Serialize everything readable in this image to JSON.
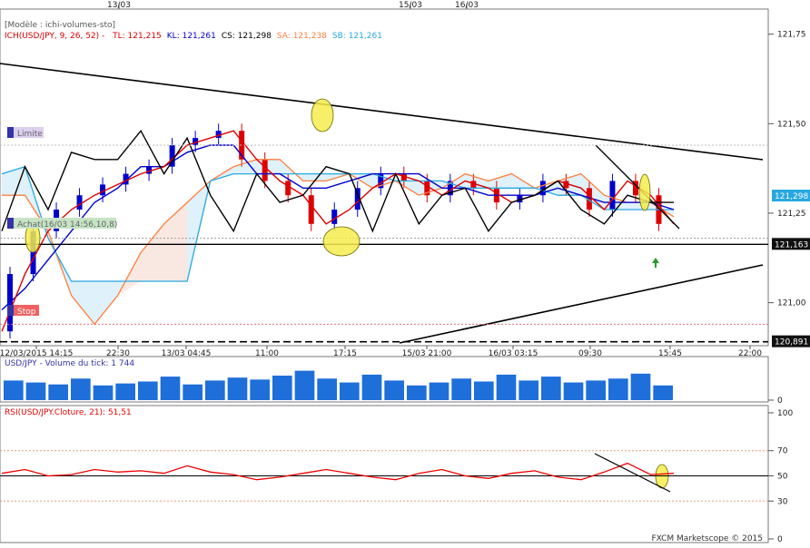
{
  "top_dates": [
    "13/03",
    "15/03",
    "16/03"
  ],
  "price_panel": {
    "model_label": "[Modèle : ichi-volumes-sto]",
    "ichimoku": {
      "prefix": "ICH(USD/JPY, 9, 26, 52) -",
      "items": [
        {
          "text": "TL: 121,215",
          "color": "#dd0000"
        },
        {
          "text": "KL: 121,261",
          "color": "#0000cc"
        },
        {
          "text": "CS: 121,298",
          "color": "#000000"
        },
        {
          "text": "SA: 121,238",
          "color": "#ff7f3f"
        },
        {
          "text": "SB: 121,261",
          "color": "#28a8e0"
        }
      ]
    },
    "y_ticks": [
      "121,75",
      "121,50",
      "121,25",
      "121,00"
    ],
    "limit_label": "Limite",
    "buy_label": "Achat(16/03 14:56,10,8)",
    "stop_label": "Stop",
    "price_boxes": [
      "121,298",
      "121,163",
      "120,891"
    ]
  },
  "time_axis": [
    "12/03/2015 14:15",
    "22:30",
    "13/03 04:45",
    "11:00",
    "17:15",
    "15/03 21:00",
    "16/03 03:15",
    "09:30",
    "15:45",
    "22:00"
  ],
  "volume_panel": {
    "title": "USD/JPY - Volume du tick: 1 744",
    "y_ticks": [
      "0"
    ]
  },
  "rsi_panel": {
    "title": "RSI(USD/JPY.Cloture, 21): 51,51",
    "y_ticks": [
      "100",
      "70",
      "50",
      "30",
      "0"
    ]
  },
  "footer": "FXCM Marketscope © 2015",
  "colors": {
    "tenkan": "#dd0000",
    "kijun": "#0000cc",
    "chikou": "#000000",
    "senkou_a": "#ff7f3f",
    "senkou_b": "#28a8e0",
    "candle_up": "#0000cc",
    "candle_down": "#dd0000",
    "volume": "#1e6fd9",
    "rsi": "#ee0000",
    "highlight": "#f5ec4c"
  },
  "chart_data": {
    "type": "line",
    "instrument": "USD/JPY",
    "price_range": [
      120.88,
      121.82
    ],
    "levels": {
      "limit": 121.44,
      "buy": 121.18,
      "stop": 120.94,
      "support_close": 121.163,
      "support_dashed": 120.891
    },
    "x_time": [
      "12/03/2015 14:15",
      "22:30",
      "13/03 04:45",
      "11:00",
      "17:15",
      "15/03 21:00",
      "16/03 03:15",
      "09:30",
      "15:45",
      "22:00"
    ],
    "series": [
      {
        "name": "TL",
        "last": 121.215,
        "values": [
          120.92,
          121.08,
          121.2,
          121.26,
          121.3,
          121.33,
          121.36,
          121.38,
          121.44,
          121.46,
          121.48,
          121.4,
          121.34,
          121.3,
          121.22,
          121.26,
          121.32,
          121.36,
          121.34,
          121.3,
          121.34,
          121.32,
          121.28,
          121.3,
          121.34,
          121.32,
          121.26,
          121.34,
          121.3,
          121.22
        ]
      },
      {
        "name": "KL",
        "last": 121.261,
        "values": [
          120.98,
          121.04,
          121.12,
          121.2,
          121.28,
          121.32,
          121.38,
          121.38,
          121.42,
          121.44,
          121.44,
          121.36,
          121.36,
          121.32,
          121.32,
          121.34,
          121.36,
          121.36,
          121.36,
          121.32,
          121.32,
          121.3,
          121.3,
          121.3,
          121.32,
          121.3,
          121.28,
          121.28,
          121.28,
          121.26
        ]
      },
      {
        "name": "CS",
        "last": 121.298,
        "values": [
          121.2,
          121.38,
          121.26,
          121.42,
          121.4,
          121.4,
          121.48,
          121.36,
          121.46,
          121.3,
          121.2,
          121.36,
          121.28,
          121.3,
          121.38,
          121.36,
          121.2,
          121.36,
          121.22,
          121.3,
          121.32,
          121.2,
          121.28,
          121.3,
          121.34,
          121.26,
          121.22,
          121.3,
          121.28,
          121.28
        ]
      },
      {
        "name": "SA",
        "last": 121.238,
        "values": [
          121.3,
          121.3,
          121.2,
          121.02,
          120.94,
          121.02,
          121.14,
          121.22,
          121.28,
          121.34,
          121.38,
          121.4,
          121.4,
          121.34,
          121.34,
          121.36,
          121.32,
          121.34,
          121.3,
          121.32,
          121.36,
          121.34,
          121.36,
          121.32,
          121.34,
          121.36,
          121.3,
          121.28,
          121.28,
          121.24
        ]
      },
      {
        "name": "SB",
        "last": 121.261,
        "values": [
          121.36,
          121.38,
          121.18,
          121.06,
          121.06,
          121.06,
          121.06,
          121.06,
          121.06,
          121.34,
          121.36,
          121.36,
          121.36,
          121.36,
          121.36,
          121.36,
          121.36,
          121.34,
          121.34,
          121.34,
          121.32,
          121.32,
          121.32,
          121.32,
          121.3,
          121.3,
          121.26,
          121.26,
          121.26,
          121.26
        ]
      }
    ],
    "volume": [
      20,
      18,
      16,
      22,
      15,
      17,
      19,
      24,
      16,
      20,
      23,
      21,
      25,
      30,
      22,
      18,
      26,
      20,
      15,
      18,
      22,
      19,
      26,
      20,
      24,
      18,
      20,
      22,
      27,
      15
    ],
    "rsi": [
      52,
      55,
      50,
      51,
      55,
      53,
      54,
      52,
      58,
      53,
      51,
      47,
      49,
      52,
      55,
      52,
      49,
      47,
      52,
      55,
      50,
      48,
      52,
      54,
      49,
      47,
      53,
      60,
      51,
      52
    ],
    "rsi_last": 51.51
  }
}
